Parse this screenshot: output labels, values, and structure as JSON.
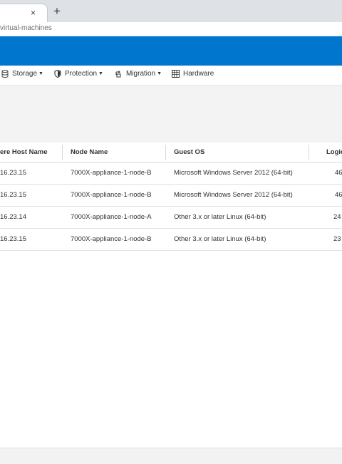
{
  "browser": {
    "new_tab_label": "+",
    "close_tab_label": "×",
    "url": "virtual-machines"
  },
  "nav": {
    "items": [
      {
        "label": "Storage",
        "icon": "database-icon",
        "has_dropdown": true
      },
      {
        "label": "Protection",
        "icon": "shield-icon",
        "has_dropdown": true
      },
      {
        "label": "Migration",
        "icon": "migration-icon",
        "has_dropdown": true
      },
      {
        "label": "Hardware",
        "icon": "hardware-grid-icon",
        "has_dropdown": false
      }
    ],
    "caret": "▼"
  },
  "table": {
    "columns": [
      "ere Host Name",
      "Node Name",
      "Guest OS",
      "Logic"
    ],
    "rows": [
      [
        "16.23.15",
        "7000X-appliance-1-node-B",
        "Microsoft Windows Server 2012 (64-bit)",
        "46"
      ],
      [
        "16.23.15",
        "7000X-appliance-1-node-B",
        "Microsoft Windows Server 2012 (64-bit)",
        "46"
      ],
      [
        "16.23.14",
        "7000X-appliance-1-node-A",
        "Other 3.x or later Linux (64-bit)",
        "24"
      ],
      [
        "16.23.15",
        "7000X-appliance-1-node-B",
        "Other 3.x or later Linux (64-bit)",
        "23"
      ]
    ]
  },
  "colors": {
    "banner": "#0076ce",
    "panel": "#f3f3f3"
  }
}
